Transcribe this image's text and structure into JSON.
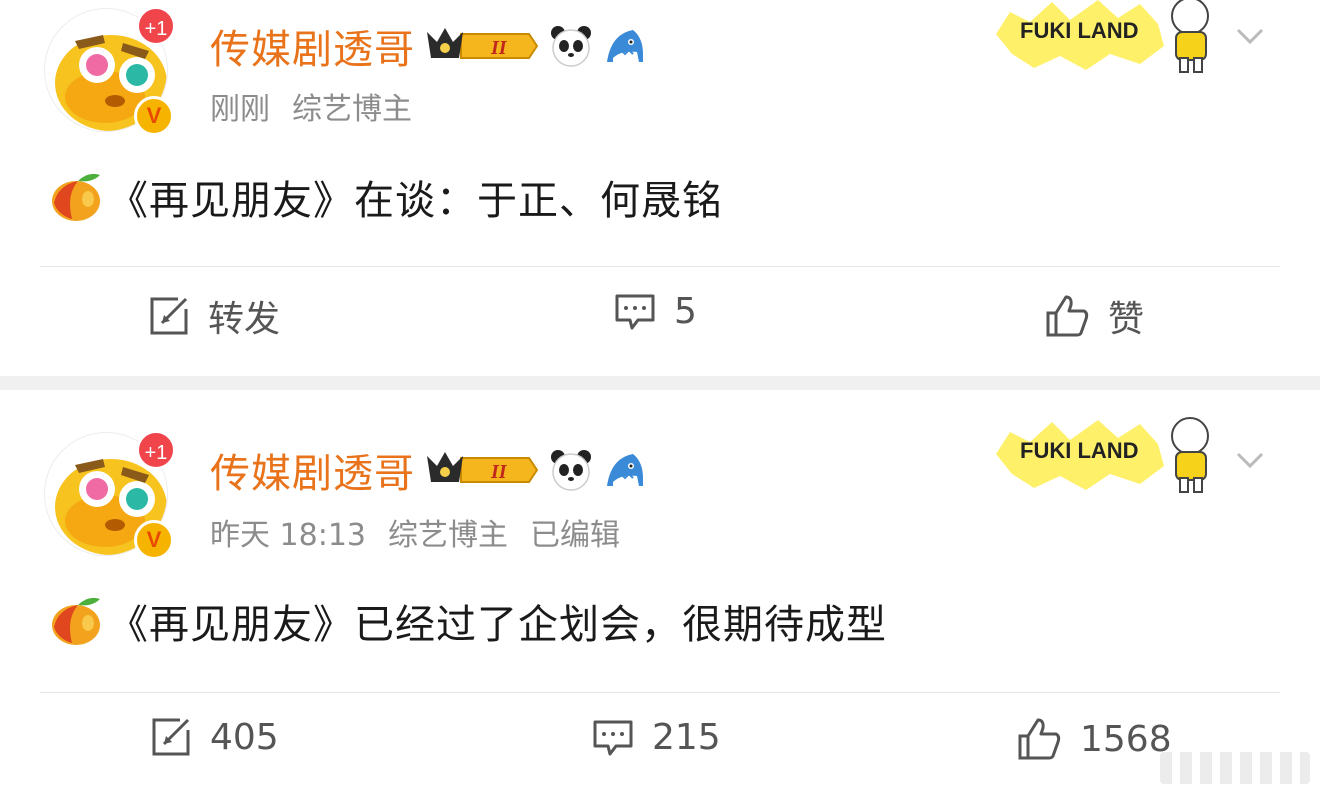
{
  "posts": [
    {
      "username": "传媒剧透哥",
      "plus_badge": "+1",
      "verified_badge": "V",
      "rank_badge": "II",
      "sticker_text": "FUKI LAND",
      "meta": {
        "time": "刚刚",
        "role": "综艺博主",
        "edited": ""
      },
      "content": "《再见朋友》在谈：于正、何晟铭",
      "actions": {
        "repost": "转发",
        "comment": "5",
        "like": "赞"
      }
    },
    {
      "username": "传媒剧透哥",
      "plus_badge": "+1",
      "verified_badge": "V",
      "rank_badge": "II",
      "sticker_text": "FUKI LAND",
      "meta": {
        "time": "昨天 18:13",
        "role": "综艺博主",
        "edited": "已编辑"
      },
      "content": "《再见朋友》已经过了企划会，很期待成型",
      "actions": {
        "repost": "405",
        "comment": "215",
        "like": "1568"
      }
    }
  ],
  "icons": {
    "repost": "repost-icon",
    "comment": "comment-icon",
    "like": "thumbs-up-icon",
    "panda": "panda-icon",
    "shark": "shark-icon",
    "mango": "mango-emoji-icon",
    "chevron": "chevron-down-icon"
  },
  "colors": {
    "username": "#e8731a",
    "meta": "#8c8c8c",
    "badge_red": "#f0454b",
    "badge_gold": "#f6b400"
  }
}
